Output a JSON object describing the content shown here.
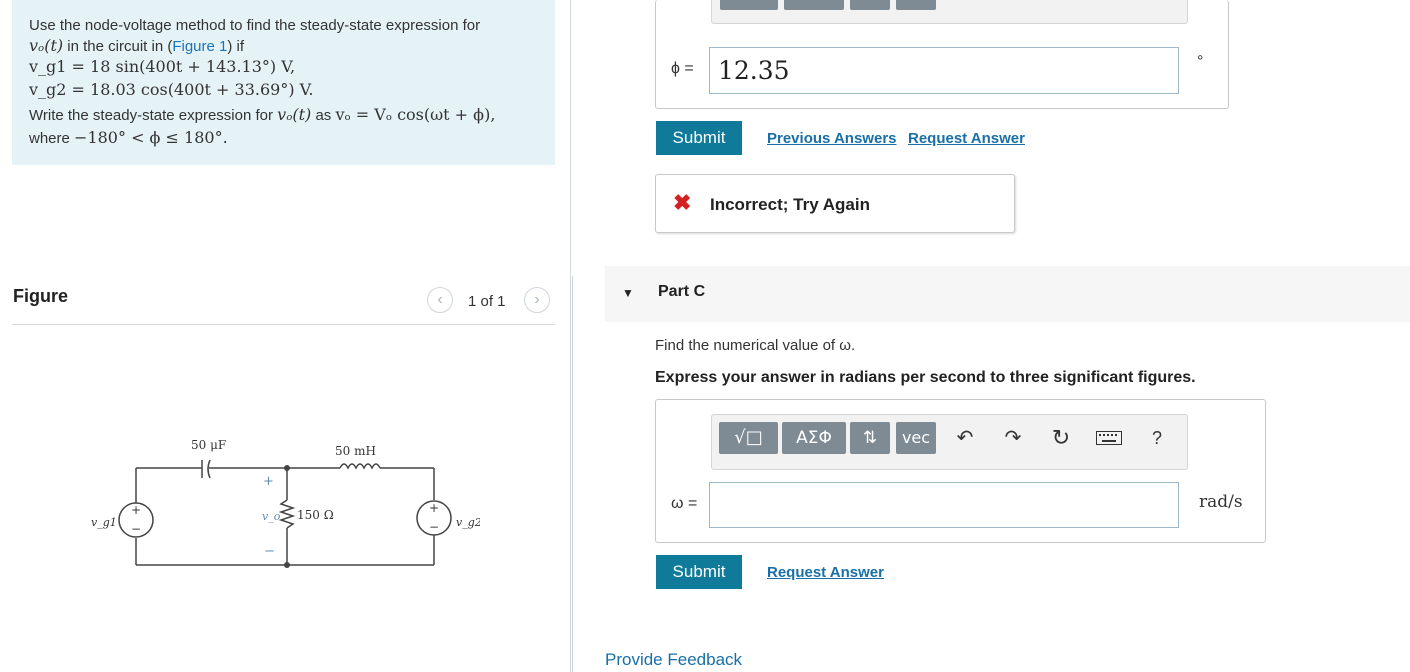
{
  "problem": {
    "line1": "Use the node-voltage method to find the steady-state expression for",
    "line2_var": "vₒ(t)",
    "line2_pre": " in the circuit in (",
    "line2_link": "Figure 1",
    "line2_post": ") if",
    "vg1_lhs": "vₑ₁",
    "vg1_expr": "v_g1 = 18 sin(400t + 143.13°) V,",
    "vg2_expr": "v_g2 = 18.03 cos(400t + 33.69°) V.",
    "line5_text": "Write the steady-state expression for",
    "line5_math1": "vₒ(t)",
    "line5_as": "as",
    "line5_math2": "vₒ = Vₒ cos(ωt + ϕ),",
    "line6_text": "where",
    "line6_math": "−180° < ϕ ≤ 180°."
  },
  "figure": {
    "heading": "Figure",
    "page_indicator": "1 of 1",
    "labels": {
      "cap": "50 μF",
      "ind": "50 mH",
      "res": "150 Ω",
      "vg1": "v_g1",
      "vg2": "v_g2",
      "vo": "v_o",
      "plus": "+",
      "minus": "−"
    }
  },
  "part_b": {
    "phi_label": "ϕ =",
    "phi_value": "12.35",
    "unit": "°",
    "submit_label": "Submit",
    "previous_answers": "Previous Answers",
    "request_answer": "Request Answer",
    "feedback_icon": "x-icon",
    "feedback_text": "Incorrect; Try Again",
    "feedback_color": "#d42020"
  },
  "part_c": {
    "title": "Part C",
    "question": "Find the numerical value of ω.",
    "instruction": "Express your answer in radians per second to three significant figures.",
    "toolbar": {
      "sqrt_btn": "√□",
      "greek_btn": "ΑΣΦ",
      "arrows_btn": "⇅",
      "vec_btn": "vec",
      "undo_icon": "undo-icon",
      "redo_icon": "redo-icon",
      "reset_icon": "reset-icon",
      "keyboard_icon": "keyboard-icon",
      "help": "?"
    },
    "omega_label": "ω =",
    "omega_value": "",
    "unit": "rad/s",
    "submit_label": "Submit",
    "request_answer": "Request Answer"
  },
  "footer": {
    "provide_feedback": "Provide Feedback"
  },
  "colors": {
    "problem_bg": "#e6f3f6",
    "submit_bg": "#0f7a9a",
    "link": "#1a6fa6"
  }
}
